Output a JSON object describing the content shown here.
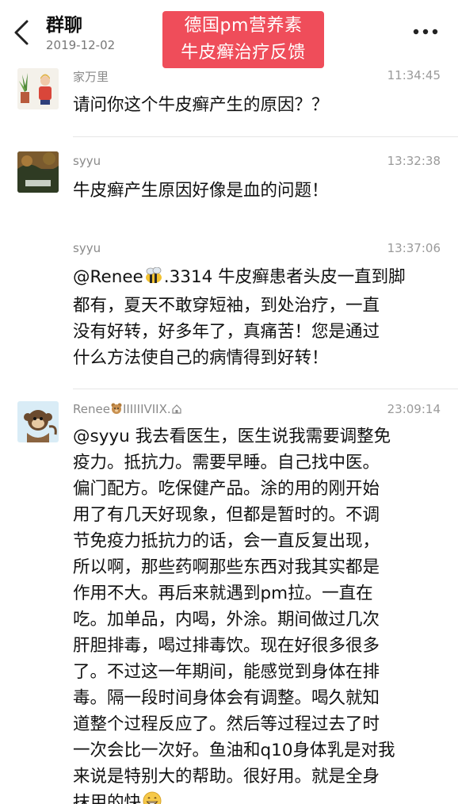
{
  "header": {
    "title": "群聊",
    "date": "2019-12-02",
    "banner_line1": "德国pm营养素",
    "banner_line2": "牛皮癣治疗反馈"
  },
  "messages": [
    {
      "sender": "家万里",
      "time": "11:34:45",
      "lines": [
        "请问你这个牛皮癣产生的原因？？"
      ]
    },
    {
      "sender": "syyu",
      "time": "13:32:38",
      "lines": [
        "牛皮癣产生原因好像是血的问题！"
      ]
    },
    {
      "sender": "syyu",
      "time": "13:37:06",
      "mention_prefix": "@Renee",
      "mention_suffix": ".3314 牛皮癣患者头皮一直到脚",
      "lines": [
        "都有，夏天不敢穿短袖，到处治疗，一直",
        "没有好转，好多年了，真痛苦！您是通过",
        "什么方法使自己的病情得到好转！"
      ]
    },
    {
      "sender_prefix": "Renee",
      "sender_suffix": "IIIIIIVIIX.",
      "time": "23:09:14",
      "lines": [
        "@syyu 我去看医生，医生说我需要调整免",
        "疫力。抵抗力。需要早睡。自己找中医。",
        "偏门配方。吃保健产品。涂的用的刚开始",
        "用了有几天好现象，但都是暂时的。不调",
        "节免疫力抵抗力的话，会一直反复出现，",
        "所以啊，那些药啊那些东西对我其实都是",
        "作用不大。再后来就遇到pm拉。一直在",
        "吃。加单品，内喝，外涂。期间做过几次",
        "肝胆排毒，喝过排毒饮。现在好很多很多",
        "了。不过这一年期间，能感觉到身体在排",
        "毒。隔一段时间身体会有调整。喝久就知",
        "道整个过程反应了。然后等过程过去了时",
        "一次会比一次好。鱼油和q10身体乳是对我",
        "来说是特别大的帮助。很好用。就是全身"
      ],
      "last_line": "抹用的快"
    }
  ]
}
